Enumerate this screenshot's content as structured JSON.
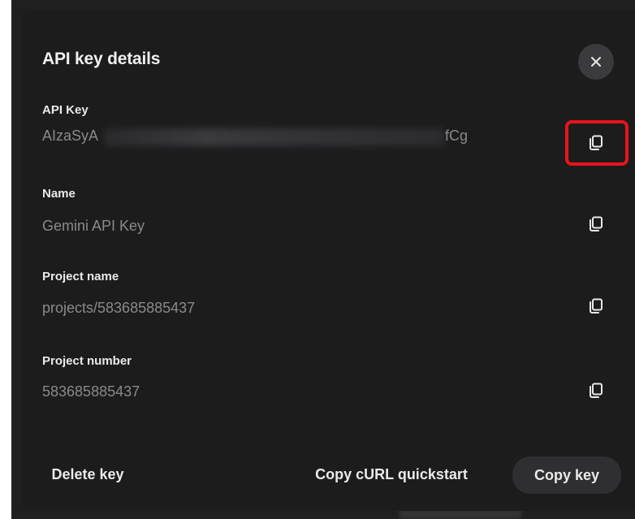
{
  "dialog": {
    "title": "API key details",
    "fields": [
      {
        "label": "API Key",
        "value_prefix": "AIzaSyA",
        "value_suffix": "fCg"
      },
      {
        "label": "Name",
        "value": "Gemini API Key"
      },
      {
        "label": "Project name",
        "value": "projects/583685885437"
      },
      {
        "label": "Project number",
        "value": "583685885437"
      }
    ],
    "footer": {
      "delete_label": "Delete key",
      "curl_label": "Copy cURL quickstart",
      "copy_key_label": "Copy key"
    }
  },
  "icons": {
    "close": "close-icon",
    "copy": "copy-icon"
  },
  "colors": {
    "dialog_bg": "#1c1c1d",
    "highlight": "#e8141b",
    "muted_text": "#8a8a8d"
  }
}
